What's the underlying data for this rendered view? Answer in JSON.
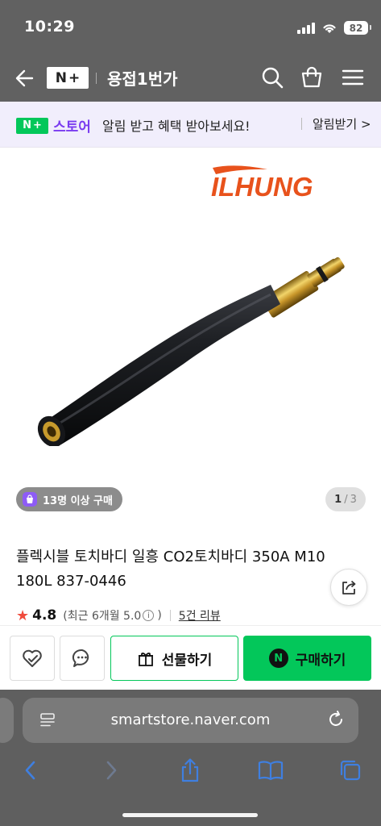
{
  "status_bar": {
    "time": "10:29",
    "battery": "82"
  },
  "header": {
    "logo_n": "N",
    "logo_plus": "+",
    "title": "용접1번가"
  },
  "banner": {
    "store_n": "N",
    "store_plus": "+",
    "store_text": "스토어",
    "message": "알림 받고 혜택 받아보세요!",
    "link": "알림받기 >"
  },
  "product_image": {
    "brand": "ILHUNG",
    "buyers_badge": "13명 이상 구매",
    "page_current": "1",
    "page_separator": "/",
    "page_total": "3"
  },
  "product": {
    "title": "플렉시블 토치바디 일흥 CO2토치바디 350A M10 180L 837-0446",
    "rating_star": "★",
    "rating": "4.8",
    "rating_detail_open": "(최근 6개월 5.0",
    "rating_info": "i",
    "rating_detail_close": ")",
    "reviews": "5건 리뷰"
  },
  "actions": {
    "gift_label": "선물하기",
    "buy_n": "N",
    "buy_label": "구매하기"
  },
  "browser": {
    "url": "smartstore.naver.com"
  },
  "colors": {
    "naver_green": "#03c75a",
    "store_purple": "#7a3cf0",
    "brand_orange": "#e8521c",
    "star_red": "#f04b3c",
    "browser_blue": "#3f7fe0"
  }
}
